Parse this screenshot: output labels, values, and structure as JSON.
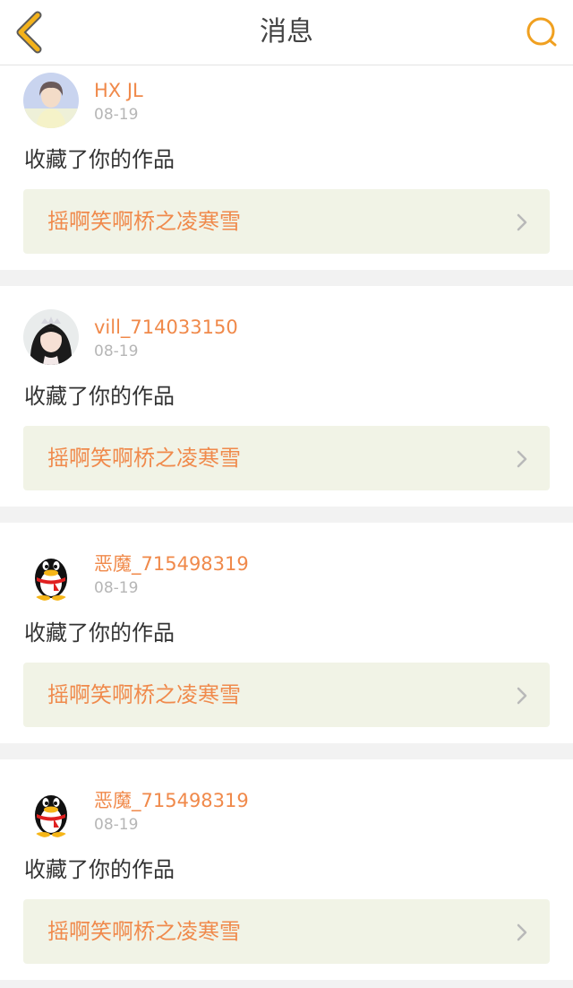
{
  "header": {
    "title": "消息",
    "accent": "#f0a020"
  },
  "messages": [
    {
      "username": "HX JL",
      "date": "08-19",
      "action": "收藏了你的作品",
      "work_title": "摇啊笑啊桥之凌寒雪",
      "avatar": "photo-avatar-boy"
    },
    {
      "username": "vill_714033150",
      "date": "08-19",
      "action": "收藏了你的作品",
      "work_title": "摇啊笑啊桥之凌寒雪",
      "avatar": "photo-avatar-girl"
    },
    {
      "username": "恶魔_715498319",
      "date": "08-19",
      "action": "收藏了你的作品",
      "work_title": "摇啊笑啊桥之凌寒雪",
      "avatar": "penguin-avatar"
    },
    {
      "username": "恶魔_715498319",
      "date": "08-19",
      "action": "收藏了你的作品",
      "work_title": "摇啊笑啊桥之凌寒雪",
      "avatar": "penguin-avatar"
    }
  ],
  "colors": {
    "username": "#f0894a",
    "work_title": "#f08a4c",
    "link_bg": "#f1f3e6",
    "date": "#b6b6b6"
  }
}
